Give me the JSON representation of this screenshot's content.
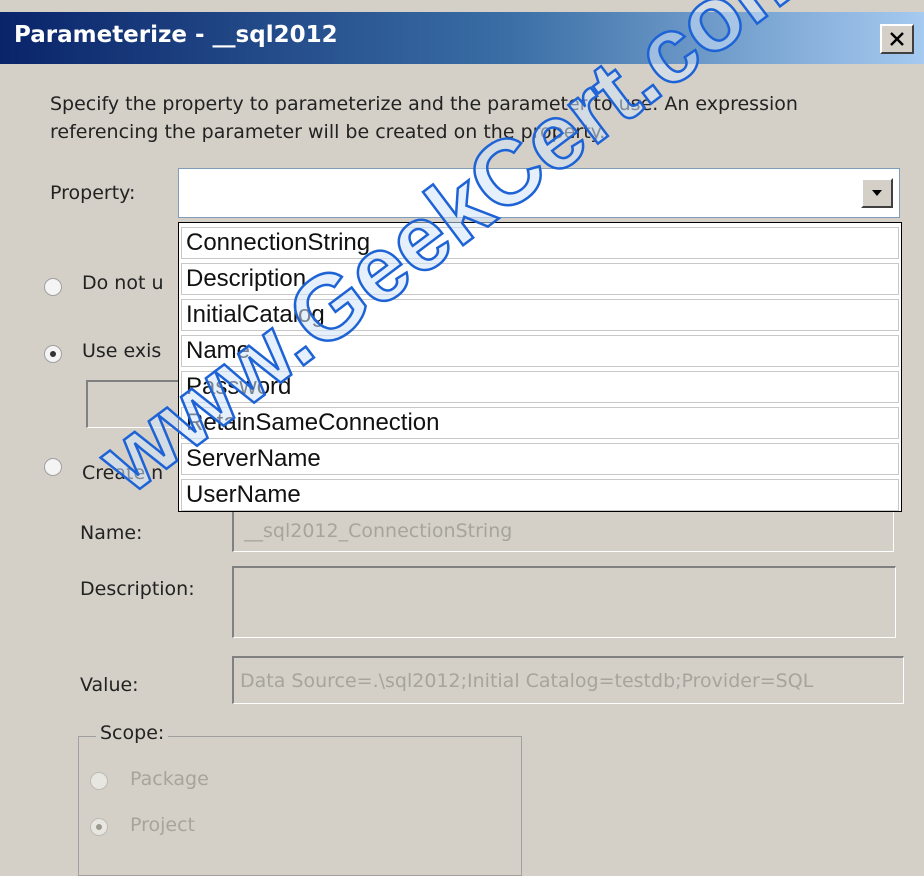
{
  "window": {
    "title": "Parameterize - __sql2012"
  },
  "intro_text": "Specify the property to parameterize and the parameter to use. An expression referencing the parameter will be created on the property.",
  "property": {
    "label": "Property:",
    "value": "",
    "options": [
      "ConnectionString",
      "Description",
      "InitialCatalog",
      "Name",
      "Password",
      "RetainSameConnection",
      "ServerName",
      "UserName"
    ]
  },
  "options": {
    "do_not_use_label": "Do not u",
    "use_existing_label": "Use exis",
    "create_new_label": "Create n"
  },
  "fields": {
    "name_label": "Name:",
    "name_value": "__sql2012_ConnectionString",
    "description_label": "Description:",
    "description_value": "",
    "value_label": "Value:",
    "value_value": "Data Source=.\\sql2012;Initial Catalog=testdb;Provider=SQL"
  },
  "scope": {
    "legend": "Scope:",
    "package_label": "Package",
    "project_label": "Project",
    "selected": "Project"
  },
  "watermark": "www.GeekCert.com",
  "icons": {
    "close": "close-icon",
    "dropdown": "chevron-down-icon"
  }
}
